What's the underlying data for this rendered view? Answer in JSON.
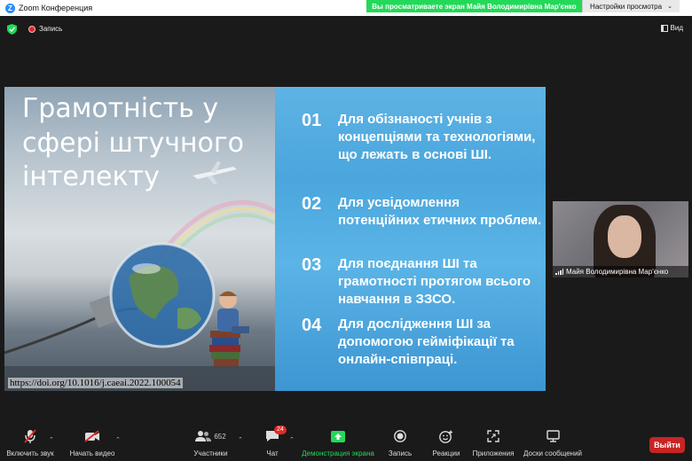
{
  "window": {
    "title": "Zoom Конференция"
  },
  "banner": {
    "viewing_text": "Вы просматриваете экран Майя Володимирівна Мар'єнко",
    "view_options_label": "Настройки просмотра"
  },
  "meeting": {
    "recording_label": "Запись",
    "view_label": "Вид"
  },
  "slide": {
    "title": "Грамотність у сфері штучного інтелекту",
    "doi": "https://doi.org/10.1016/j.caeai.2022.100054",
    "items": [
      {
        "num": "01",
        "text": "Для обізнаності учнів з концепціями та технологіями, що лежать в основі ШІ."
      },
      {
        "num": "02",
        "text": "Для усвідомлення потенційних етичних проблем."
      },
      {
        "num": "03",
        "text": "Для поєднання ШІ та грамотності протягом всього навчання в ЗЗСО."
      },
      {
        "num": "04",
        "text": "Для дослідження ШІ за допомогою гейміфікації та онлайн-співпраці."
      }
    ]
  },
  "participant": {
    "name": "Майя Володимирівна Мар'єнко"
  },
  "toolbar": {
    "audio_label": "Включить звук",
    "video_label": "Начать видео",
    "participants_label": "Участники",
    "participants_count": "652",
    "chat_label": "Чат",
    "chat_badge": "24",
    "share_label": "Демонстрация экрана",
    "record_label": "Запись",
    "reactions_label": "Реакции",
    "apps_label": "Приложения",
    "whiteboards_label": "Доски сообщений",
    "leave_label": "Выйти"
  },
  "colors": {
    "accent": "#2d8cff",
    "banner_green": "#23d959",
    "leave_red": "#c72424",
    "slide_blue": "#4aa6dd"
  }
}
